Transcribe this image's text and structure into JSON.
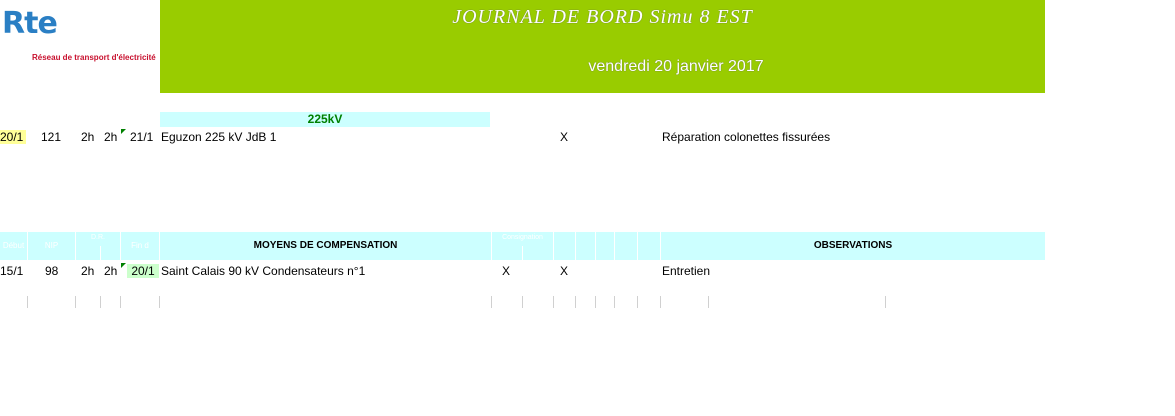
{
  "logo": {
    "brand": "Rte",
    "tagline": "Réseau de transport d'électricité"
  },
  "banner": {
    "title": "JOURNAL DE BORD Simu 8 EST",
    "date": "vendredi 20 janvier 2017"
  },
  "section_225": {
    "label": "225kV"
  },
  "row_225": {
    "date_start": "20/1",
    "num": "121",
    "dur1": "2h",
    "dur2": "2h",
    "date_end": "21/1",
    "ouvrage": "Eguzon 225 kV JdB 1",
    "mark": "X",
    "observation": "Réparation colonettes fissurées"
  },
  "header": {
    "col_debut": "Début",
    "col_nip": "NIP",
    "col_dr": "D.R.",
    "col_fin": "Fin d",
    "col_moyens": "MOYENS DE COMPENSATION",
    "col_consignation": "Consignation",
    "col_observations": "OBSERVATIONS"
  },
  "row_comp": {
    "date_start": "15/1",
    "num": "98",
    "dur1": "2h",
    "dur2": "2h",
    "date_end": "20/1",
    "ouvrage": "Saint Calais 90 kV Condensateurs n°1",
    "mark1": "X",
    "mark2": "X",
    "observation": "Entretien"
  },
  "colors": {
    "banner": "#99cc00",
    "section": "#ccffff",
    "section_text": "#008000",
    "highlight_yellow": "#ffff99",
    "highlight_green": "#ccffcc"
  }
}
